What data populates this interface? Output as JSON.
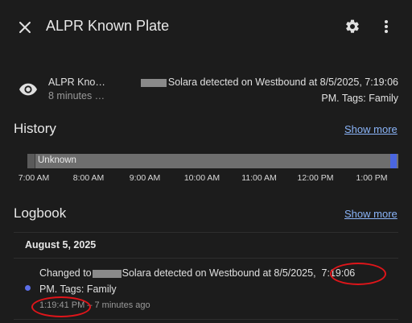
{
  "header": {
    "title": "ALPR Known Plate",
    "close_icon": "close-icon",
    "settings_icon": "gear-icon",
    "more_icon": "more-vertical-icon"
  },
  "entity": {
    "name": "ALPR Kno…",
    "last_changed": "8 minutes …",
    "state_line1": "Solara detected on Westbound at 8/5/2025, 7:19:06",
    "state_line2": "PM. Tags: Family",
    "icon": "eye-icon"
  },
  "history": {
    "title": "History",
    "show_more": "Show more",
    "bar_state": "Unknown",
    "ticks": [
      "7:00 AM",
      "8:00 AM",
      "9:00 AM",
      "10:00 AM",
      "11:00 AM",
      "12:00 PM",
      "1:00 PM"
    ]
  },
  "logbook": {
    "title": "Logbook",
    "show_more": "Show more",
    "date": "August 5, 2025",
    "entry": {
      "prefix": "Changed to",
      "text": "Solara detected on Westbound at 8/5/2025,",
      "time_highlight": "7:19:06",
      "line2": "PM. Tags: Family",
      "timestamp": "1:19:41 PM",
      "relative": "7 minutes ago"
    }
  },
  "colors": {
    "background": "#1c1c1c",
    "link": "#8ab4f8",
    "accent": "#5b6ee8",
    "annotation": "#e0151a"
  }
}
